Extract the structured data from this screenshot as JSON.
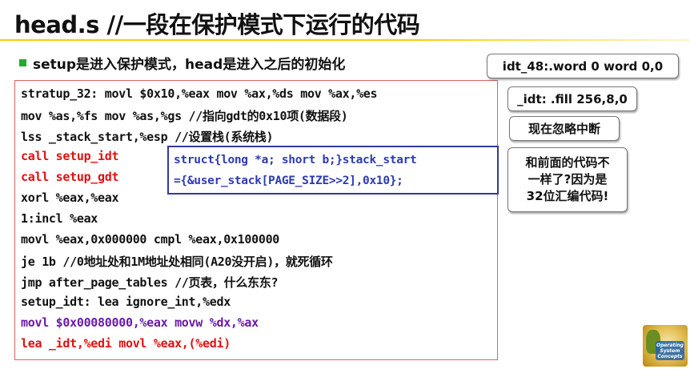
{
  "slide": {
    "title": "head.s //一段在保护模式下运行的代码",
    "bullet": "setup是进入保护模式，head是进入之后的初始化"
  },
  "code": {
    "lines": [
      {
        "text": "stratup_32: movl $0x10,%eax  mov %ax,%ds  mov %ax,%es",
        "color": "black"
      },
      {
        "text": "  mov %as,%fs  mov %as,%gs  //指向gdt的0x10项(数据段)",
        "color": "black"
      },
      {
        "text": "  lss _stack_start,%esp  //设置栈(系统栈)",
        "color": "black"
      },
      {
        "text": "  call setup_idt",
        "color": "red"
      },
      {
        "text": "  call setup_gdt",
        "color": "red"
      },
      {
        "text": "  xorl %eax,%eax",
        "color": "black"
      },
      {
        "text": "1:incl %eax",
        "color": "black"
      },
      {
        "text": "  movl %eax,0x000000 cmpl %eax,0x100000",
        "color": "black"
      },
      {
        "text": "  je 1b   //0地址处和1M地址处相同(A20没开启)，就死循环",
        "color": "black"
      },
      {
        "text": "  jmp after_page_tables  //页表，什么东东?",
        "color": "black"
      },
      {
        "text": "setup_idt: lea ignore_int,%edx",
        "color": "black"
      },
      {
        "text": "  movl $0x00080000,%eax  movw %dx,%ax",
        "color": "purple"
      },
      {
        "text": "  lea _idt,%edi  movl %eax,(%edi)",
        "color": "red"
      }
    ]
  },
  "overlay": {
    "line1": "struct{long *a; short b;}stack_start",
    "line2": "={&user_stack[PAGE_SIZE>>2],0x10};"
  },
  "notes": {
    "idt48": "idt_48:.word 0  word 0,0",
    "idt_fill": "_idt: .fill 256,8,0",
    "ignore_int": "现在忽略中断",
    "diff_line1": "和前面的代码不",
    "diff_line2": "一样了?因为是",
    "diff_line3": "32位汇编代码!"
  },
  "logo": {
    "text": "Operating System Concepts"
  },
  "colors": {
    "code_red": "#e01010",
    "code_purple": "#6a1aa8",
    "overlay_blue": "#2d3bb0",
    "bullet_green": "#22aa33",
    "title_rule": "#ffcc00"
  }
}
